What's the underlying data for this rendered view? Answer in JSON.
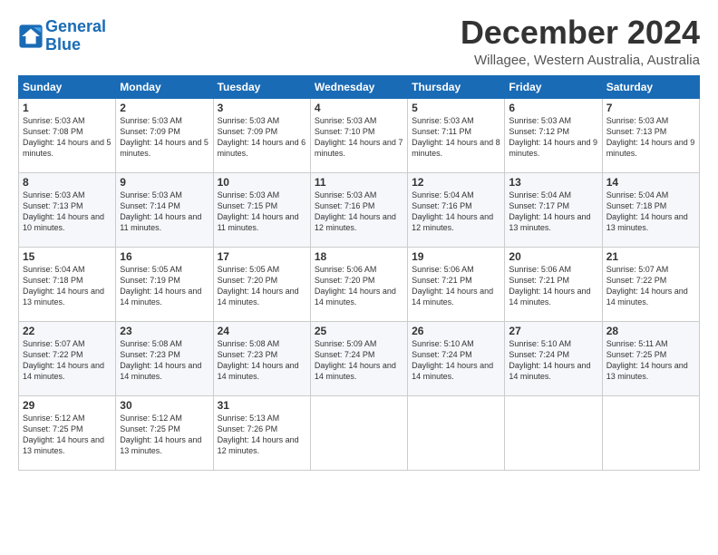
{
  "logo": {
    "line1": "General",
    "line2": "Blue"
  },
  "title": "December 2024",
  "location": "Willagee, Western Australia, Australia",
  "days_of_week": [
    "Sunday",
    "Monday",
    "Tuesday",
    "Wednesday",
    "Thursday",
    "Friday",
    "Saturday"
  ],
  "weeks": [
    [
      {
        "day": "1",
        "sunrise": "5:03 AM",
        "sunset": "7:08 PM",
        "daylight": "14 hours and 5 minutes."
      },
      {
        "day": "2",
        "sunrise": "5:03 AM",
        "sunset": "7:09 PM",
        "daylight": "14 hours and 5 minutes."
      },
      {
        "day": "3",
        "sunrise": "5:03 AM",
        "sunset": "7:09 PM",
        "daylight": "14 hours and 6 minutes."
      },
      {
        "day": "4",
        "sunrise": "5:03 AM",
        "sunset": "7:10 PM",
        "daylight": "14 hours and 7 minutes."
      },
      {
        "day": "5",
        "sunrise": "5:03 AM",
        "sunset": "7:11 PM",
        "daylight": "14 hours and 8 minutes."
      },
      {
        "day": "6",
        "sunrise": "5:03 AM",
        "sunset": "7:12 PM",
        "daylight": "14 hours and 9 minutes."
      },
      {
        "day": "7",
        "sunrise": "5:03 AM",
        "sunset": "7:13 PM",
        "daylight": "14 hours and 9 minutes."
      }
    ],
    [
      {
        "day": "8",
        "sunrise": "5:03 AM",
        "sunset": "7:13 PM",
        "daylight": "14 hours and 10 minutes."
      },
      {
        "day": "9",
        "sunrise": "5:03 AM",
        "sunset": "7:14 PM",
        "daylight": "14 hours and 11 minutes."
      },
      {
        "day": "10",
        "sunrise": "5:03 AM",
        "sunset": "7:15 PM",
        "daylight": "14 hours and 11 minutes."
      },
      {
        "day": "11",
        "sunrise": "5:03 AM",
        "sunset": "7:16 PM",
        "daylight": "14 hours and 12 minutes."
      },
      {
        "day": "12",
        "sunrise": "5:04 AM",
        "sunset": "7:16 PM",
        "daylight": "14 hours and 12 minutes."
      },
      {
        "day": "13",
        "sunrise": "5:04 AM",
        "sunset": "7:17 PM",
        "daylight": "14 hours and 13 minutes."
      },
      {
        "day": "14",
        "sunrise": "5:04 AM",
        "sunset": "7:18 PM",
        "daylight": "14 hours and 13 minutes."
      }
    ],
    [
      {
        "day": "15",
        "sunrise": "5:04 AM",
        "sunset": "7:18 PM",
        "daylight": "14 hours and 13 minutes."
      },
      {
        "day": "16",
        "sunrise": "5:05 AM",
        "sunset": "7:19 PM",
        "daylight": "14 hours and 14 minutes."
      },
      {
        "day": "17",
        "sunrise": "5:05 AM",
        "sunset": "7:20 PM",
        "daylight": "14 hours and 14 minutes."
      },
      {
        "day": "18",
        "sunrise": "5:06 AM",
        "sunset": "7:20 PM",
        "daylight": "14 hours and 14 minutes."
      },
      {
        "day": "19",
        "sunrise": "5:06 AM",
        "sunset": "7:21 PM",
        "daylight": "14 hours and 14 minutes."
      },
      {
        "day": "20",
        "sunrise": "5:06 AM",
        "sunset": "7:21 PM",
        "daylight": "14 hours and 14 minutes."
      },
      {
        "day": "21",
        "sunrise": "5:07 AM",
        "sunset": "7:22 PM",
        "daylight": "14 hours and 14 minutes."
      }
    ],
    [
      {
        "day": "22",
        "sunrise": "5:07 AM",
        "sunset": "7:22 PM",
        "daylight": "14 hours and 14 minutes."
      },
      {
        "day": "23",
        "sunrise": "5:08 AM",
        "sunset": "7:23 PM",
        "daylight": "14 hours and 14 minutes."
      },
      {
        "day": "24",
        "sunrise": "5:08 AM",
        "sunset": "7:23 PM",
        "daylight": "14 hours and 14 minutes."
      },
      {
        "day": "25",
        "sunrise": "5:09 AM",
        "sunset": "7:24 PM",
        "daylight": "14 hours and 14 minutes."
      },
      {
        "day": "26",
        "sunrise": "5:10 AM",
        "sunset": "7:24 PM",
        "daylight": "14 hours and 14 minutes."
      },
      {
        "day": "27",
        "sunrise": "5:10 AM",
        "sunset": "7:24 PM",
        "daylight": "14 hours and 14 minutes."
      },
      {
        "day": "28",
        "sunrise": "5:11 AM",
        "sunset": "7:25 PM",
        "daylight": "14 hours and 13 minutes."
      }
    ],
    [
      {
        "day": "29",
        "sunrise": "5:12 AM",
        "sunset": "7:25 PM",
        "daylight": "14 hours and 13 minutes."
      },
      {
        "day": "30",
        "sunrise": "5:12 AM",
        "sunset": "7:25 PM",
        "daylight": "14 hours and 13 minutes."
      },
      {
        "day": "31",
        "sunrise": "5:13 AM",
        "sunset": "7:26 PM",
        "daylight": "14 hours and 12 minutes."
      },
      null,
      null,
      null,
      null
    ]
  ]
}
